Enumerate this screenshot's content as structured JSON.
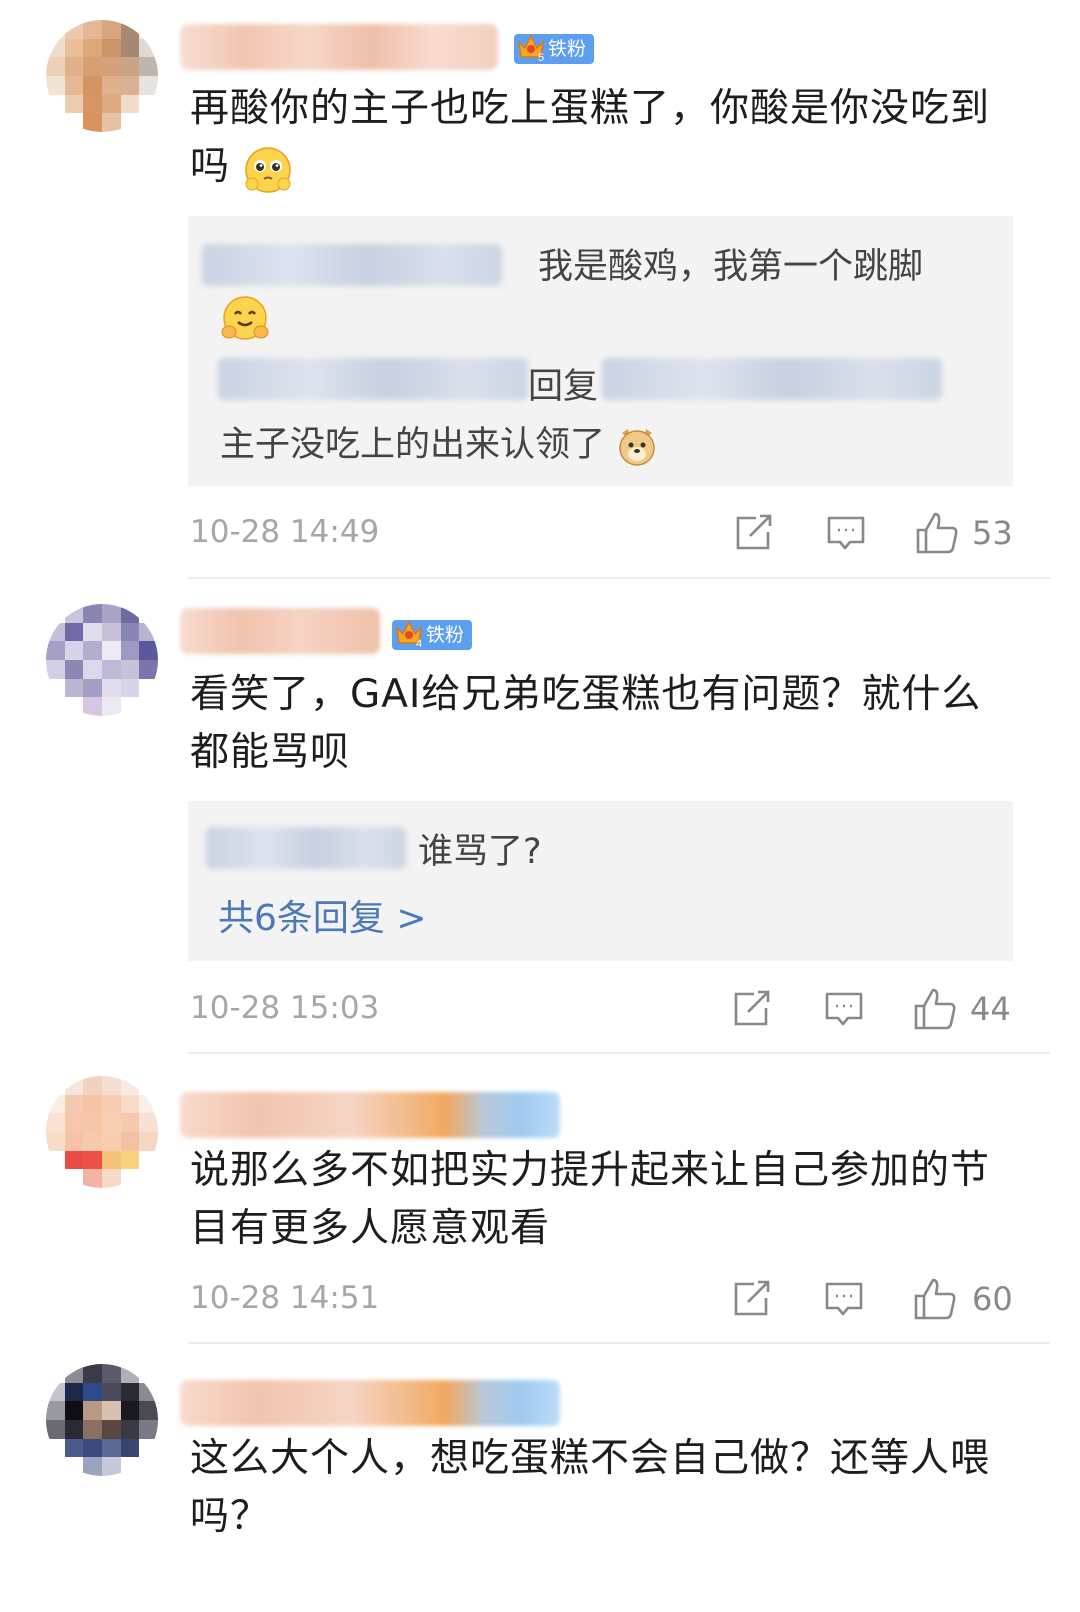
{
  "comments": [
    {
      "badge": "铁粉",
      "badge_level": "5",
      "text": "再酸你的主子也吃上蛋糕了，你酸是你没吃到吗",
      "text_line1": "再酸你的主子也吃上蛋糕了，你酸是你没吃到",
      "text_line2": "吗",
      "replies": [
        {
          "text_line1": "我是酸鸡，我第一个跳脚"
        },
        {
          "reply_word": "回复",
          "text": "主子没吃上的出来认领了"
        }
      ],
      "time": "10-28 14:49",
      "likes": "53"
    },
    {
      "badge": "铁粉",
      "badge_level": "4",
      "text_line1": "看笑了，GAI给兄弟吃蛋糕也有问题？就什么",
      "text_line2": "都能骂呗",
      "replies": [
        {
          "text": "谁骂了?"
        }
      ],
      "more_replies": "共6条回复 >",
      "time": "10-28 15:03",
      "likes": "44"
    },
    {
      "text_line1": "说那么多不如把实力提升起来让自己参加的节",
      "text_line2": "目有更多人愿意观看",
      "time": "10-28 14:51",
      "likes": "60"
    },
    {
      "text_line1": "这么大个人，想吃蛋糕不会自己做？还等人喂",
      "text_line2": "吗？"
    }
  ],
  "icons": {
    "share": "share-icon",
    "comment": "comment-icon",
    "like": "thumbs-up-icon"
  },
  "colors": {
    "badge": "#5c9ff2",
    "link": "#4a78b8",
    "meta": "#a6a6a6"
  }
}
